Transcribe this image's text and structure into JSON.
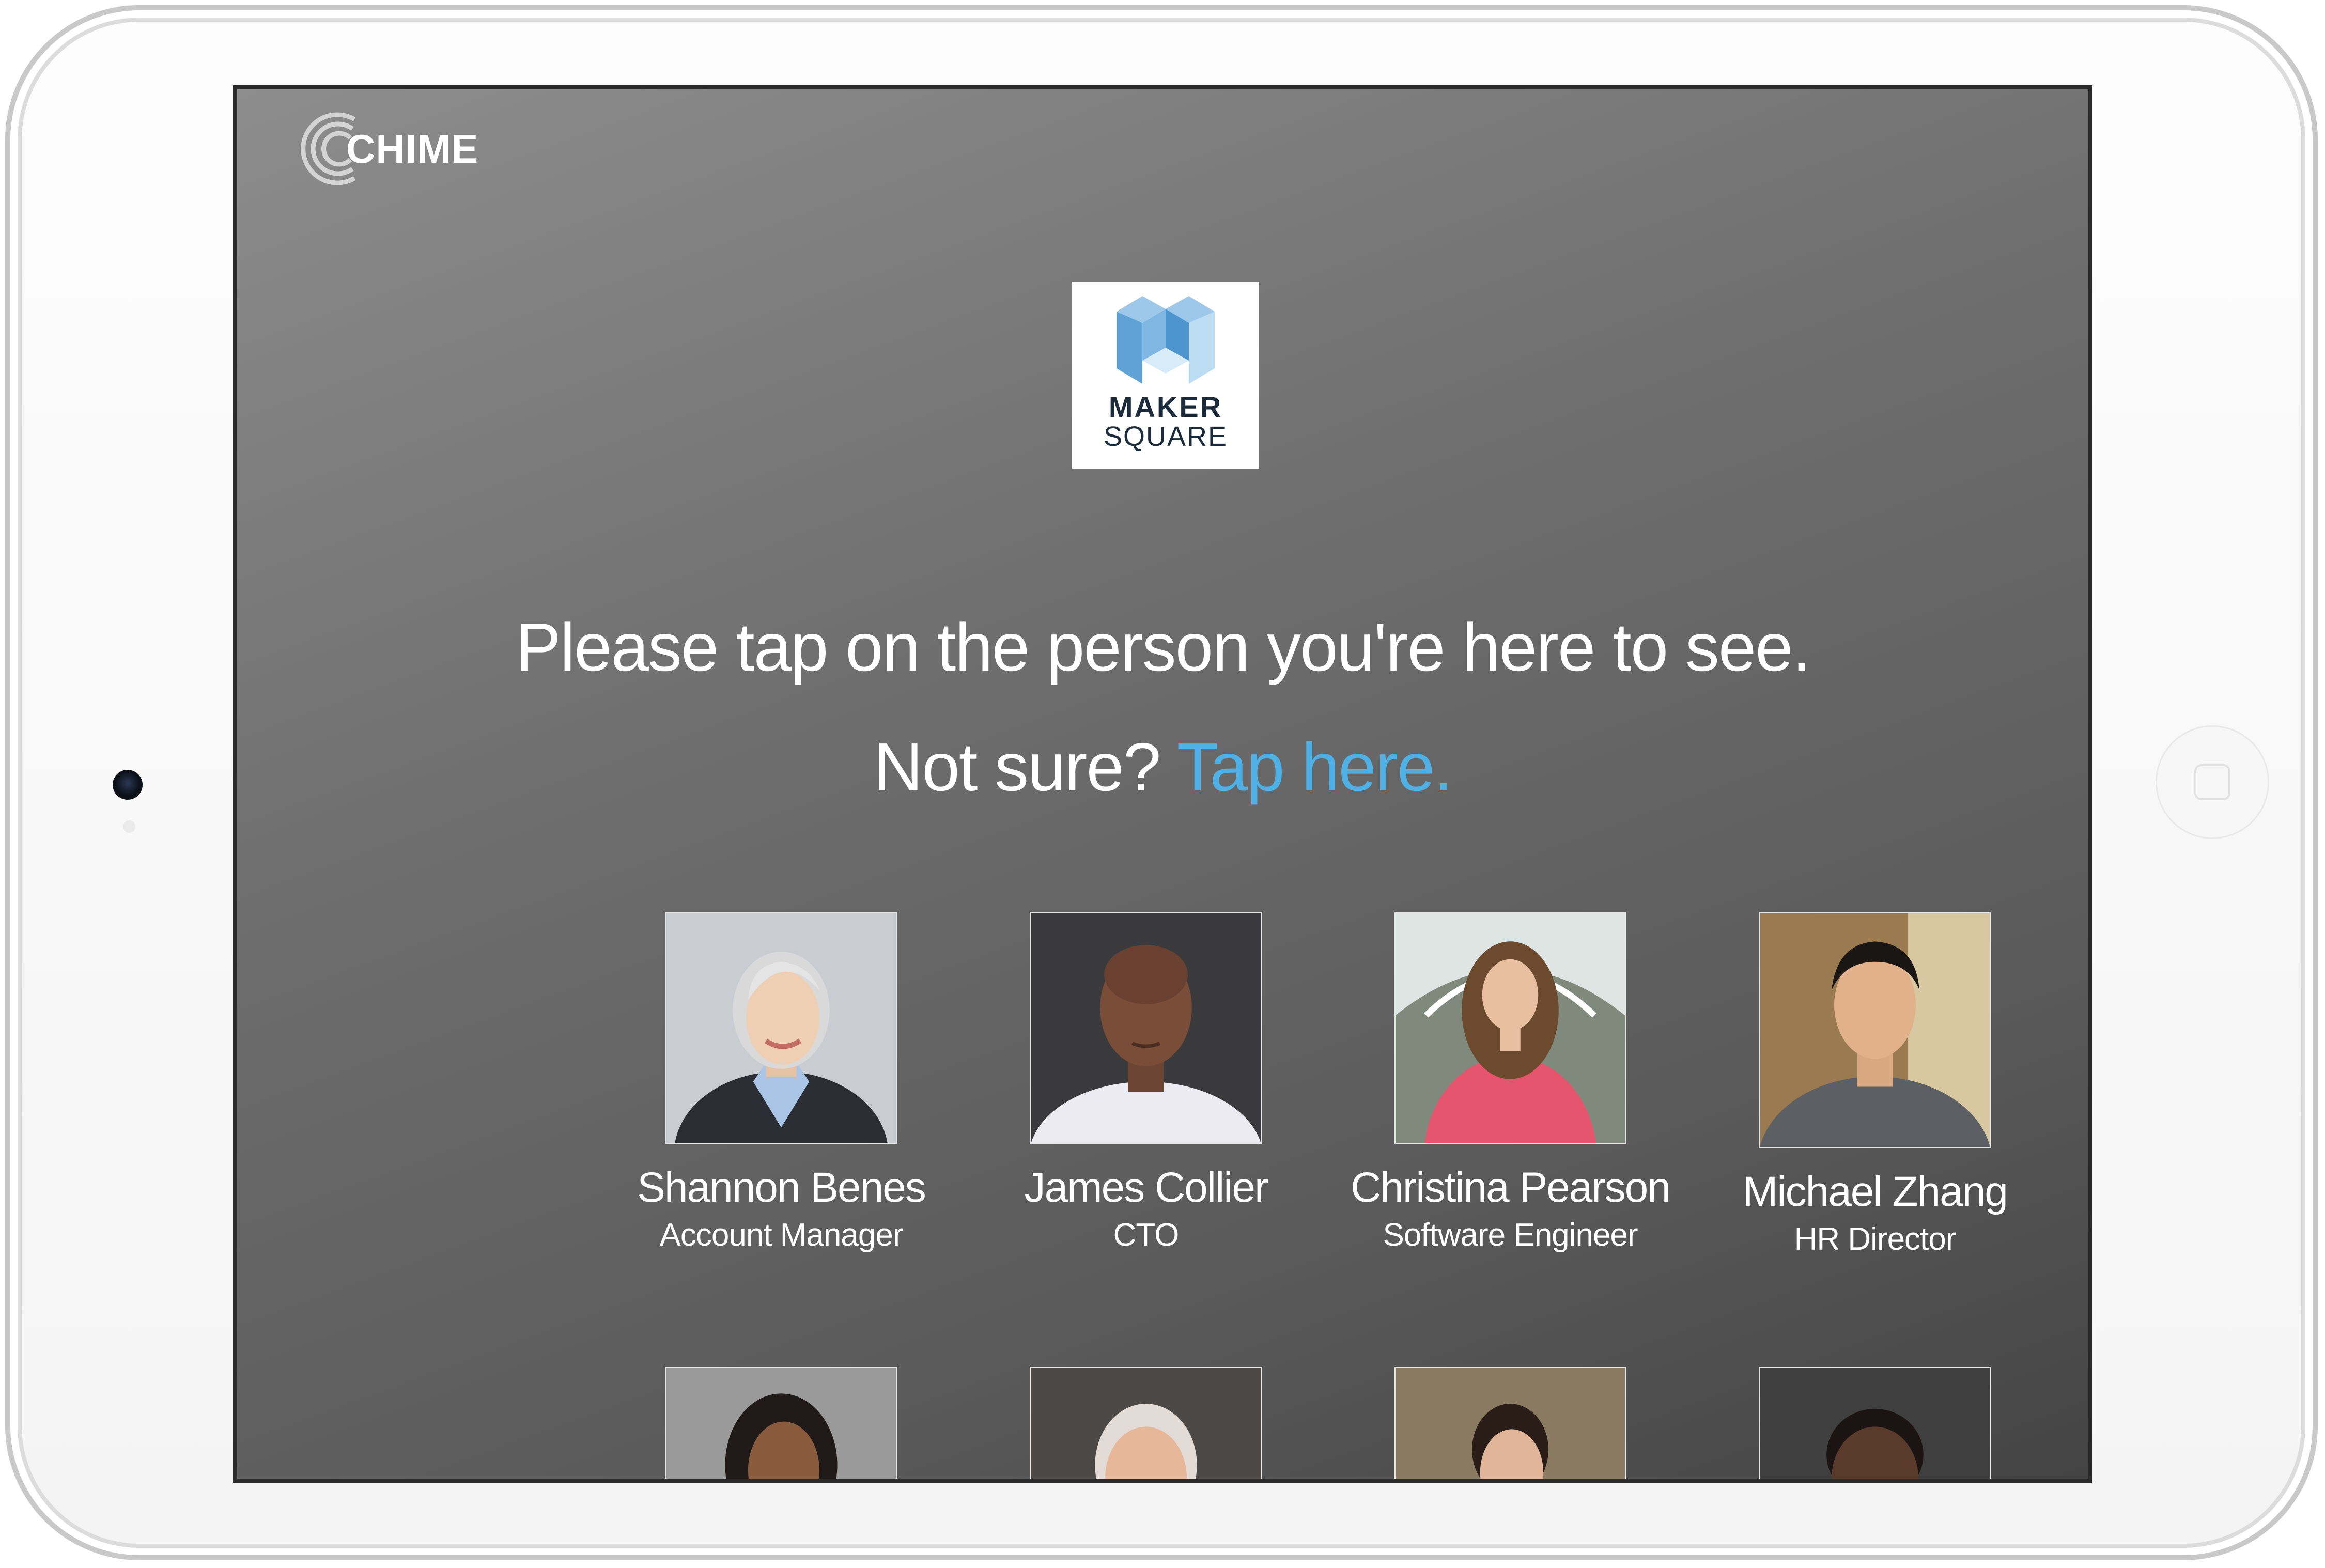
{
  "kiosk": {
    "brand": "CHIME",
    "company": {
      "name_top": "MAKER",
      "name_bottom": "SQUARE"
    },
    "prompt": "Please tap on the person you're here to see.",
    "not_sure_text": "Not sure?",
    "tap_here_link": "Tap here.",
    "accent_color": "#4eb0e4"
  },
  "people": [
    {
      "name": "Shannon Benes",
      "title": "Account Manager"
    },
    {
      "name": "James Collier",
      "title": "CTO"
    },
    {
      "name": "Christina Pearson",
      "title": "Software Engineer"
    },
    {
      "name": "Michael Zhang",
      "title": "HR Director"
    }
  ],
  "people_row2": [
    {
      "name": "",
      "title": ""
    },
    {
      "name": "",
      "title": ""
    },
    {
      "name": "",
      "title": ""
    },
    {
      "name": "",
      "title": ""
    }
  ]
}
